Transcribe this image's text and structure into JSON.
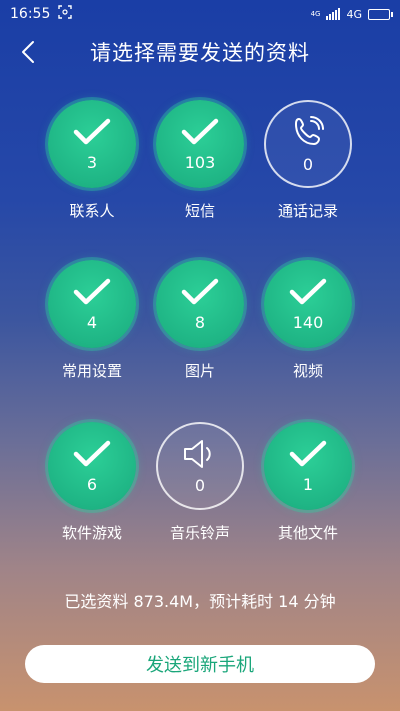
{
  "status_bar": {
    "time": "16:55",
    "network": "4G",
    "signal_small": "4G"
  },
  "header": {
    "title": "请选择需要发送的资料"
  },
  "items": [
    {
      "label": "联系人",
      "count": "3",
      "checked": true,
      "icon": "check-icon"
    },
    {
      "label": "短信",
      "count": "103",
      "checked": true,
      "icon": "check-icon"
    },
    {
      "label": "通话记录",
      "count": "0",
      "checked": false,
      "icon": "phone-icon"
    },
    {
      "label": "常用设置",
      "count": "4",
      "checked": true,
      "icon": "check-icon"
    },
    {
      "label": "图片",
      "count": "8",
      "checked": true,
      "icon": "check-icon"
    },
    {
      "label": "视频",
      "count": "140",
      "checked": true,
      "icon": "check-icon"
    },
    {
      "label": "软件游戏",
      "count": "6",
      "checked": true,
      "icon": "check-icon"
    },
    {
      "label": "音乐铃声",
      "count": "0",
      "checked": false,
      "icon": "speaker-icon"
    },
    {
      "label": "其他文件",
      "count": "1",
      "checked": true,
      "icon": "check-icon"
    }
  ],
  "summary": "已选资料 873.4M，预计耗时 14 分钟",
  "send_button": "发送到新手机",
  "colors": {
    "accent_green": "#1fb585",
    "button_text": "#1aa67a"
  }
}
